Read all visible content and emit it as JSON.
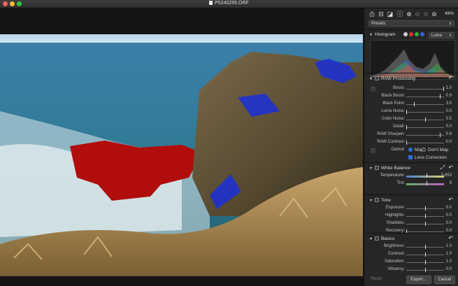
{
  "window": {
    "title": "P5240295.ORF"
  },
  "toolbar": {
    "zoom": "49%"
  },
  "presets": {
    "label": "Presets"
  },
  "histogram": {
    "title": "Histogram",
    "channel": "Luma",
    "channel_colors": [
      "#d0d0d0",
      "#e03030",
      "#30b030",
      "#3060e0"
    ]
  },
  "raw": {
    "title": "RAW Processing",
    "rows": [
      {
        "label": "Boost:",
        "value": "1.0",
        "pos": 1.0
      },
      {
        "label": "Black Boost:",
        "value": "0.9",
        "pos": 0.9
      },
      {
        "label": "Black Point:",
        "value": "3.0",
        "pos": 0.2
      },
      {
        "label": "Luma Noise:",
        "value": "0.0",
        "pos": 0.0
      },
      {
        "label": "Color Noise:",
        "value": "0.5",
        "pos": 0.5
      },
      {
        "label": "Detail:",
        "value": "0.0",
        "pos": 0.0
      },
      {
        "label": "RAW Sharpen:",
        "value": "0.9",
        "pos": 0.9
      },
      {
        "label": "RAW Contrast:",
        "value": "0.0",
        "pos": 0.0
      }
    ],
    "gamut_label": "Gamut:",
    "gamut_map": "Map",
    "gamut_dont": "Don't Map",
    "lens": "Lens Correction"
  },
  "wb": {
    "title": "White Balance",
    "rows": [
      {
        "label": "Temperature:",
        "value": "5,653",
        "pos": 0.55
      },
      {
        "label": "Tint:",
        "value": "9",
        "pos": 0.55
      }
    ]
  },
  "tone": {
    "title": "Tone",
    "rows": [
      {
        "label": "Exposure:",
        "value": "0.0",
        "pos": 0.5
      },
      {
        "label": "Highlights:",
        "value": "0.0",
        "pos": 0.5
      },
      {
        "label": "Shadows:",
        "value": "0.0",
        "pos": 0.5
      },
      {
        "label": "Recovery:",
        "value": "0.0",
        "pos": 0.0
      }
    ]
  },
  "basics": {
    "title": "Basics",
    "rows": [
      {
        "label": "Brightness:",
        "value": "1.0",
        "pos": 0.5
      },
      {
        "label": "Contrast:",
        "value": "1.0",
        "pos": 0.5
      },
      {
        "label": "Saturation:",
        "value": "1.0",
        "pos": 0.5
      },
      {
        "label": "Vibrancy:",
        "value": "0.0",
        "pos": 0.5
      }
    ]
  },
  "footer": {
    "reset": "Reset",
    "export": "Export…",
    "cancel": "Cancel"
  }
}
